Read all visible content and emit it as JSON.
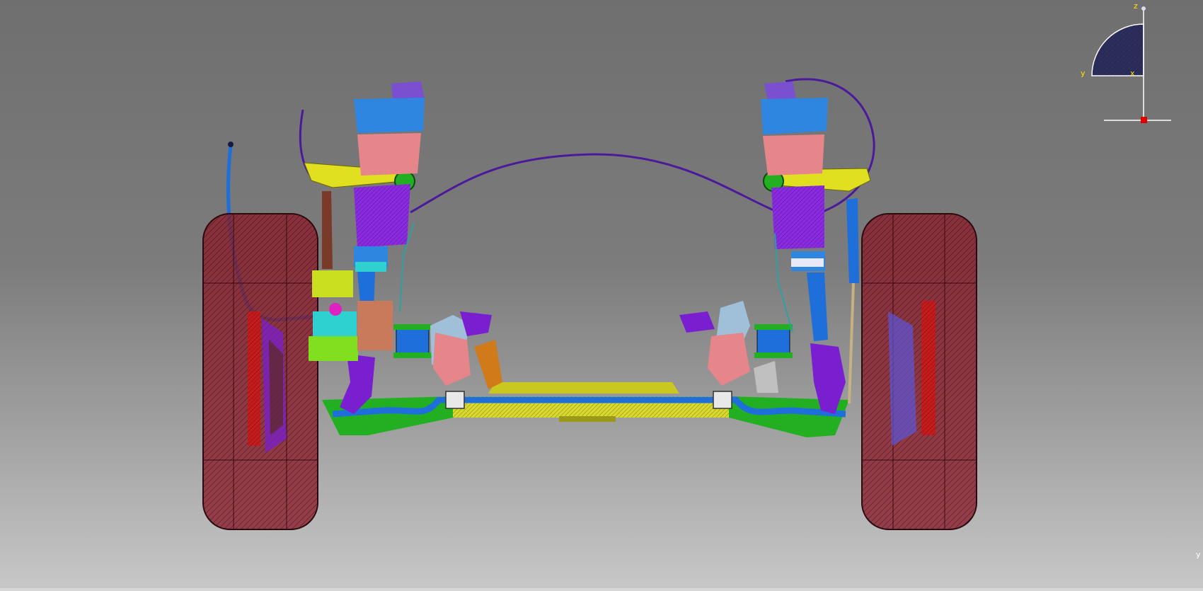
{
  "viewer": {
    "background_top": "#6f6f6f",
    "background_bottom": "#c8c8c8"
  },
  "compass": {
    "z_label": "z",
    "y_label": "y",
    "x_label": "x",
    "fill_color": "#2b2d5a",
    "axis_color": "#ffffff",
    "label_color": "#ffe600",
    "origin_marker_color": "#e00000"
  },
  "corner_label": "y",
  "assembly": {
    "tire_color": "#8b1c2a",
    "airspring_top_color": "#2f86e0",
    "airspring_body_color": "#e6858a",
    "airspring_bellows_color": "#8a2be2",
    "upper_arm_color": "#e0e020",
    "subframe_color": "#d8d82e",
    "stabilizer_bar_color": "#1e6fd9",
    "lower_arm_color": "#22b022",
    "knuckle_color": "#7a1fd0",
    "brake_rotor_color": "#d01818",
    "harness_color": "#4b1a9a"
  }
}
